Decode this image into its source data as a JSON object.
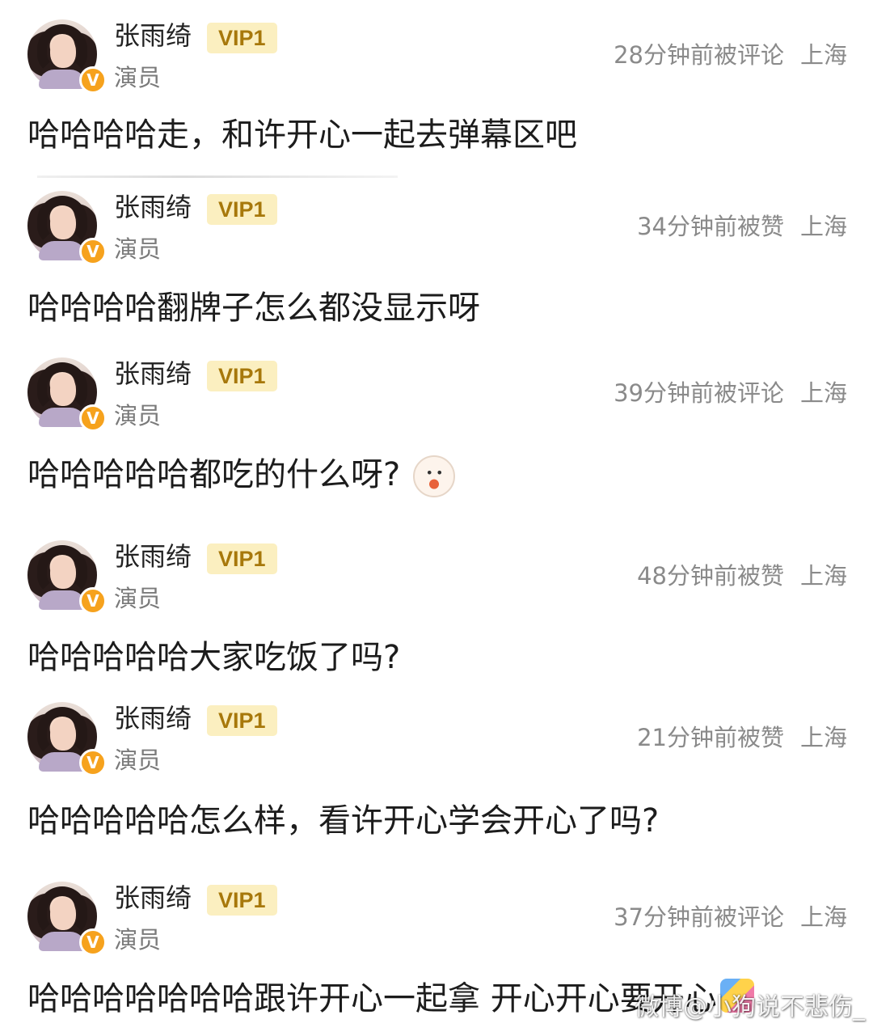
{
  "comments": [
    {
      "name": "张雨绮",
      "badge": "VIP1",
      "verified_badge": "V",
      "role": "演员",
      "time": "28分钟前被评论",
      "location": "上海",
      "text": "哈哈哈哈走，和许开心一起去弹幕区吧"
    },
    {
      "name": "张雨绮",
      "badge": "VIP1",
      "verified_badge": "V",
      "role": "演员",
      "time": "34分钟前被赞",
      "location": "上海",
      "text": "哈哈哈哈翻牌子怎么都没显示呀"
    },
    {
      "name": "张雨绮",
      "badge": "VIP1",
      "verified_badge": "V",
      "role": "演员",
      "time": "39分钟前被评论",
      "location": "上海",
      "text": "哈哈哈哈哈都吃的什么呀?",
      "emoji": "laughing-duck-emoji"
    },
    {
      "name": "张雨绮",
      "badge": "VIP1",
      "verified_badge": "V",
      "role": "演员",
      "time": "48分钟前被赞",
      "location": "上海",
      "text": "哈哈哈哈哈大家吃饭了吗?"
    },
    {
      "name": "张雨绮",
      "badge": "VIP1",
      "verified_badge": "V",
      "role": "演员",
      "time": "21分钟前被赞",
      "location": "上海",
      "text": "哈哈哈哈哈怎么样，看许开心学会开心了吗?"
    },
    {
      "name": "张雨绮",
      "badge": "VIP1",
      "verified_badge": "V",
      "role": "演员",
      "time": "37分钟前被评论",
      "location": "上海",
      "text": "哈哈哈哈哈哈哈跟许开心一起拿 开心开心要开心",
      "emoji": "celebration-emoji"
    }
  ],
  "watermark": "微博@小狗说不悲伤_"
}
